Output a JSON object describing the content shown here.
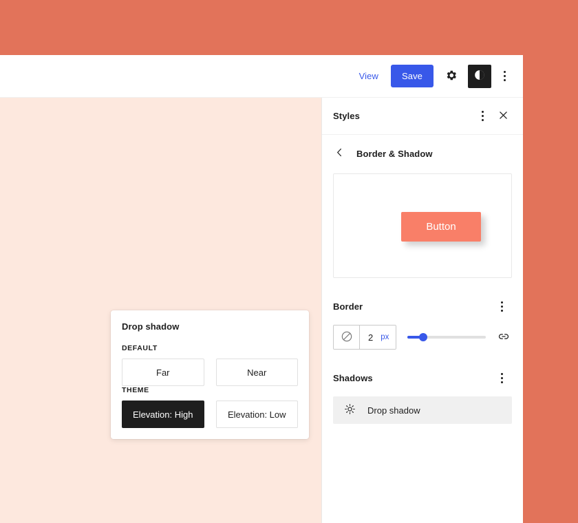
{
  "theme": {
    "page_background": "#E2735A",
    "canvas_background": "#FDE8DE",
    "accent_blue": "#3858E9",
    "selected_dark": "#1E1E1E",
    "preview_button_color": "#F97F68"
  },
  "toolbar": {
    "view_label": "View",
    "save_label": "Save",
    "settings_icon": "gear-icon",
    "styles_icon": "contrast-half-circle-icon",
    "more_icon": "three-dots-vertical-icon"
  },
  "sidebar": {
    "header": {
      "title": "Styles",
      "more_icon": "three-dots-vertical-icon",
      "close_icon": "close-x-icon"
    },
    "nav": {
      "back_icon": "chevron-left-icon",
      "panel_title": "Border & Shadow"
    },
    "preview": {
      "button_label": "Button"
    },
    "border": {
      "label": "Border",
      "more_icon": "three-dots-vertical-icon",
      "color_icon": "no-color-slash-circle-icon",
      "width_value": "2",
      "width_unit": "px",
      "slider_percent": 20,
      "link_icon": "link-sides-icon"
    },
    "shadows": {
      "label": "Shadows",
      "more_icon": "three-dots-vertical-icon",
      "items": [
        {
          "icon": "shadow-sun-icon",
          "name": "Drop shadow"
        }
      ]
    }
  },
  "popover": {
    "title": "Drop shadow",
    "groups": [
      {
        "label": "DEFAULT",
        "options": [
          {
            "label": "Far",
            "selected": false
          },
          {
            "label": "Near",
            "selected": false
          }
        ]
      },
      {
        "label": "THEME",
        "options": [
          {
            "label": "Elevation: High",
            "selected": true
          },
          {
            "label": "Elevation: Low",
            "selected": false
          }
        ]
      }
    ]
  }
}
